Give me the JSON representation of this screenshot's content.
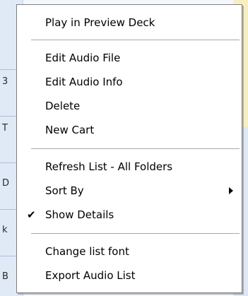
{
  "background": {
    "row_fragments": [
      "3",
      "T",
      "D",
      "k",
      "B"
    ]
  },
  "menu": {
    "items": [
      {
        "label": "Play in Preview Deck"
      },
      {
        "label": "Edit Audio File"
      },
      {
        "label": "Edit Audio Info"
      },
      {
        "label": "Delete"
      },
      {
        "label": "New Cart"
      },
      {
        "label": "Refresh List - All Folders"
      },
      {
        "label": "Sort By",
        "submenu": true
      },
      {
        "label": "Show Details",
        "checked": true
      },
      {
        "label": "Change list font"
      },
      {
        "label": "Export Audio List"
      }
    ],
    "check_glyph": "✔"
  }
}
